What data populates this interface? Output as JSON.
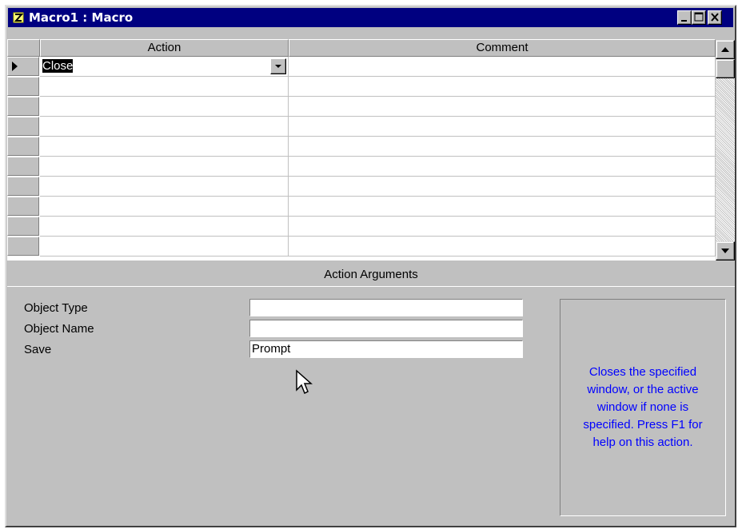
{
  "window": {
    "title": "Macro1 : Macro",
    "icon": "macro-icon",
    "controls": [
      "minimize-icon",
      "maximize-icon",
      "close-icon"
    ]
  },
  "grid": {
    "columns": [
      "Action",
      "Comment"
    ],
    "rows": [
      {
        "action": "Close",
        "comment": "",
        "current": true
      },
      {
        "action": "",
        "comment": ""
      },
      {
        "action": "",
        "comment": ""
      },
      {
        "action": "",
        "comment": ""
      },
      {
        "action": "",
        "comment": ""
      },
      {
        "action": "",
        "comment": ""
      },
      {
        "action": "",
        "comment": ""
      },
      {
        "action": "",
        "comment": ""
      },
      {
        "action": "",
        "comment": ""
      },
      {
        "action": "",
        "comment": ""
      }
    ]
  },
  "arguments": {
    "header": "Action Arguments",
    "fields": [
      {
        "label": "Object Type",
        "value": ""
      },
      {
        "label": "Object Name",
        "value": ""
      },
      {
        "label": "Save",
        "value": "Prompt"
      }
    ],
    "help": "Closes the specified window, or the active window if none is specified. Press F1 for help on this action."
  },
  "colors": {
    "titlebar": "#000080",
    "face": "#c0c0c0",
    "help_text": "#0000ff"
  }
}
